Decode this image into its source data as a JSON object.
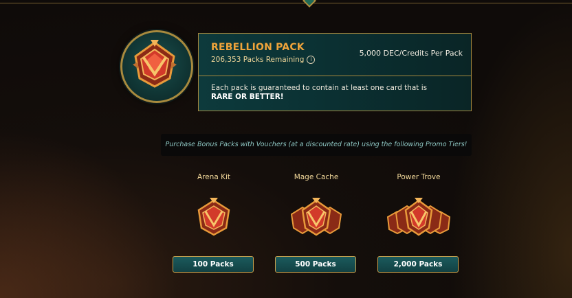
{
  "pack": {
    "title": "REBELLION PACK",
    "remaining": "206,353 Packs Remaining",
    "price": "5,000 DEC/Credits Per Pack",
    "guarantee_text": "Each pack is guaranteed to contain at least one card that is",
    "guarantee_bold": "RARE OR BETTER!"
  },
  "promo": {
    "text": "Purchase Bonus Packs with Vouchers (at a discounted rate) using the following Promo Tiers!"
  },
  "tiers": [
    {
      "name": "Arena Kit",
      "button": "100 Packs"
    },
    {
      "name": "Mage Cache",
      "button": "500 Packs"
    },
    {
      "name": "Power Trove",
      "button": "2,000 Packs"
    }
  ],
  "colors": {
    "accent_gold": "#a88a3e",
    "title_orange": "#f0a43a",
    "panel_teal": "#0d3a3c"
  },
  "icons": {
    "info": "info-icon",
    "pack": "pack-chest-icon"
  }
}
